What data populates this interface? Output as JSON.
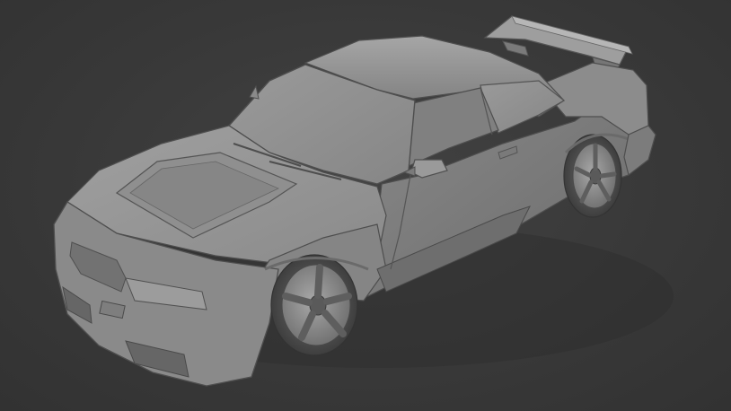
{
  "scene": {
    "subject": "car-3d-model-render",
    "background_color": "#3a3a3a",
    "body_color": "#8e8e8e",
    "highlight_color": "#b4b4b4",
    "shadow_color": "#5a5a5a"
  }
}
